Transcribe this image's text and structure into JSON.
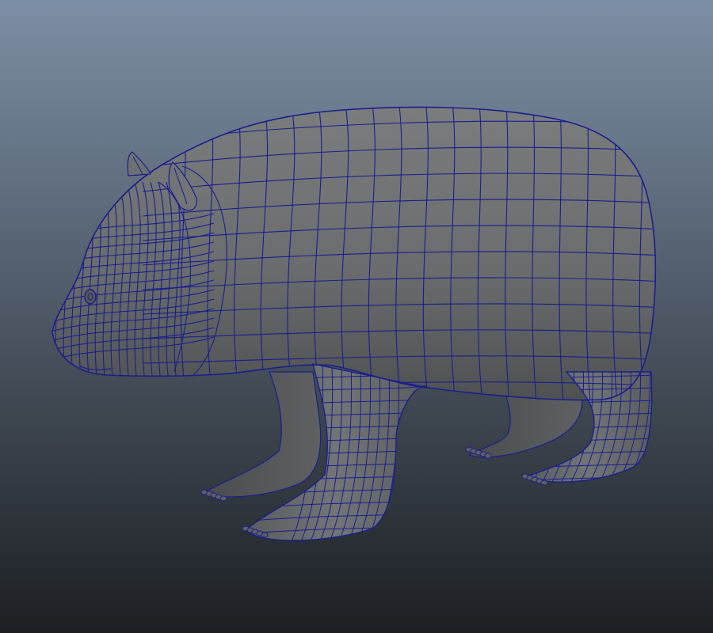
{
  "viewport": {
    "background_top": "#7d8fa6",
    "background_bottom": "#1c1f22",
    "mesh_fill": "#6a6c6e",
    "mesh_fill_dark": "#3c3d3f",
    "wireframe_color": "#1a1f8c",
    "model": "quadruped-mesh"
  }
}
